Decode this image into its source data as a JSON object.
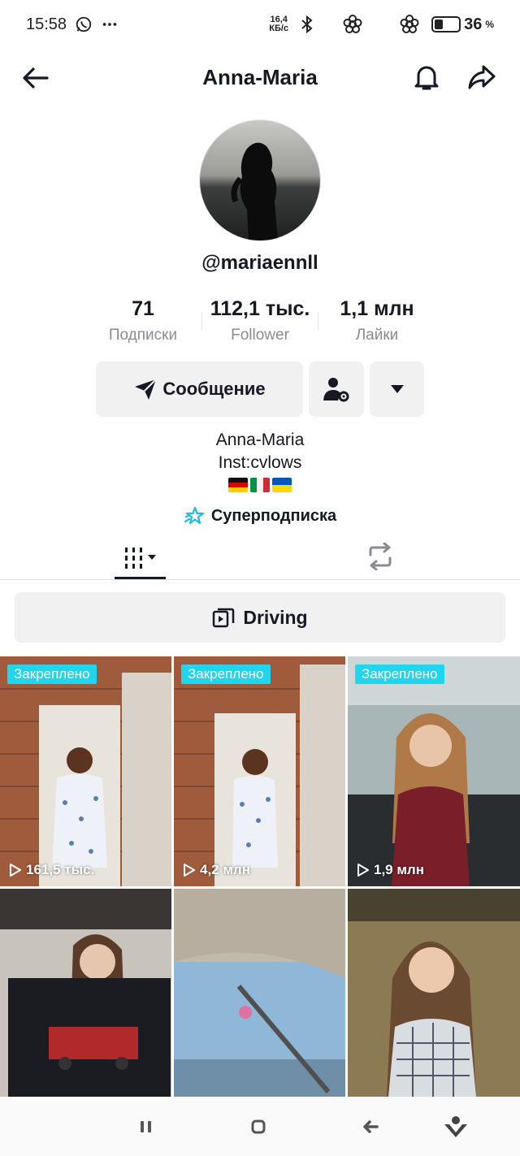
{
  "status_bar": {
    "time": "15:58",
    "net_speed_value": "16,4",
    "net_speed_unit": "КБ/с",
    "battery_percent": "36",
    "battery_suffix": "%",
    "battery_level": 0.36,
    "icons": [
      "whatsapp-icon",
      "more-dots-icon",
      "bluetooth-icon",
      "flower-icon",
      "flower-icon",
      "battery-icon"
    ]
  },
  "header": {
    "title": "Anna-Maria",
    "icons": [
      "back-arrow-icon",
      "bell-icon",
      "share-icon"
    ]
  },
  "profile": {
    "username": "@mariaennll",
    "stats": [
      {
        "value": "71",
        "label": "Подписки"
      },
      {
        "value": "112,1 тыс.",
        "label": "Follower"
      },
      {
        "value": "1,1 млн",
        "label": "Лайки"
      }
    ],
    "message_button": "Сообщение",
    "bio_name": "Anna-Maria",
    "bio_line": "Inst:cvlows",
    "bio_flags": [
      "germany",
      "italy",
      "ukraine"
    ],
    "superfollow": "Суперподписка"
  },
  "tabs": {
    "videos_icon": "grid-icon",
    "repost_icon": "repost-icon"
  },
  "playlist": {
    "label": "Driving"
  },
  "videos": [
    {
      "pinned": "Закреплено",
      "views": "161,5 тыс."
    },
    {
      "pinned": "Закреплено",
      "views": "4,2 млн"
    },
    {
      "pinned": "Закреплено",
      "views": "1,9 млн"
    },
    {
      "pinned": "",
      "views": ""
    },
    {
      "pinned": "",
      "views": ""
    },
    {
      "pinned": "",
      "views": ""
    }
  ],
  "colors": {
    "accent": "#20d5ec",
    "text": "#161823",
    "secondary": "#8a8b91",
    "button_bg": "#f1f1f2"
  }
}
